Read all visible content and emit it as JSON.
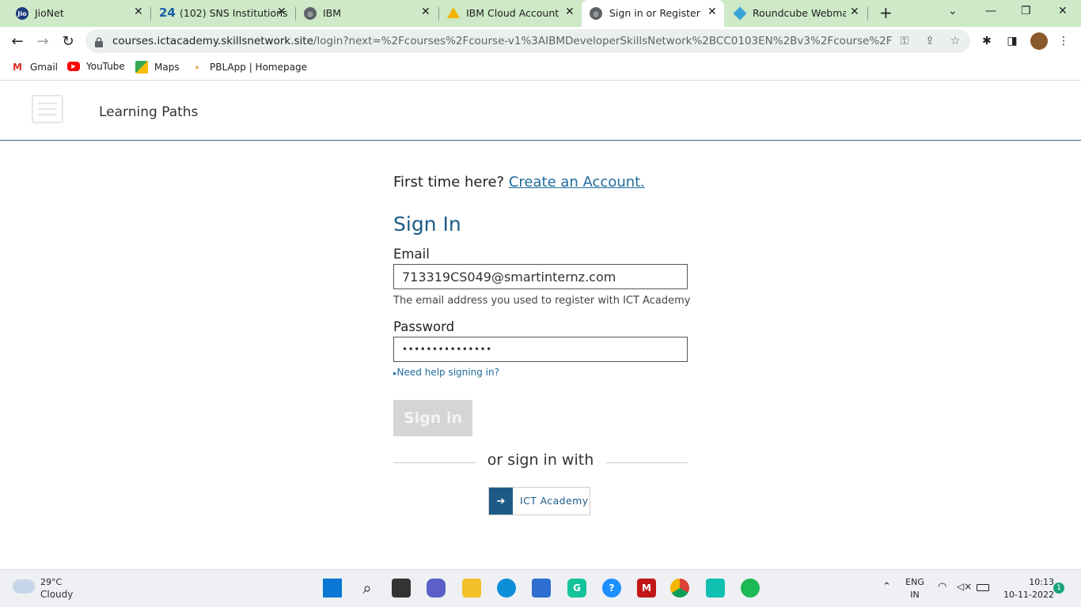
{
  "browser": {
    "tabs": [
      {
        "label": "JioNet",
        "icon": "jio-icon"
      },
      {
        "label": "(102) SNS Institutions",
        "icon": "sns-24-icon"
      },
      {
        "label": "IBM",
        "icon": "globe-icon"
      },
      {
        "label": "IBM Cloud Account Cr",
        "icon": "google-drive-icon"
      },
      {
        "label": "Sign in or Register | IC",
        "icon": "globe-icon"
      },
      {
        "label": "Roundcube Webmail ::",
        "icon": "roundcube-icon"
      }
    ],
    "url_host": "courses.ictacademy.skillsnetwork.site",
    "url_path": "/login?next=%2Fcourses%2Fcourse-v1%3AIBMDeveloperSkillsNetwork%2BCC0103EN%2Bv3%2Fcourse%2F",
    "bookmarks": [
      {
        "label": "Gmail",
        "icon": "gmail-icon"
      },
      {
        "label": "YouTube",
        "icon": "youtube-icon"
      },
      {
        "label": "Maps",
        "icon": "maps-icon"
      },
      {
        "label": "PBLApp | Homepage",
        "icon": "pblapp-icon"
      }
    ]
  },
  "site": {
    "nav_link": "Learning Paths"
  },
  "login": {
    "first_time": "First time here?",
    "create_account": "Create an Account.",
    "title": "Sign In",
    "email_label": "Email",
    "email_value": "713319CS049@smartinternz.com",
    "email_hint": "The email address you used to register with ICT Academy",
    "password_label": "Password",
    "password_value": "•••••••••••••••",
    "help_link": "Need help signing in?",
    "signin_button": "Sign in",
    "or_text": "or sign in with",
    "provider_label": "ICT Academy"
  },
  "taskbar": {
    "weather_temp": "29°C",
    "weather_condition": "Cloudy",
    "lang_top": "ENG",
    "lang_bottom": "IN",
    "time": "10:13",
    "date": "10-11-2022",
    "notification_count": "1"
  },
  "colors": {
    "tab_strip": "#cde9c7",
    "accent": "#1d5b86",
    "link": "#1e6b9c"
  }
}
